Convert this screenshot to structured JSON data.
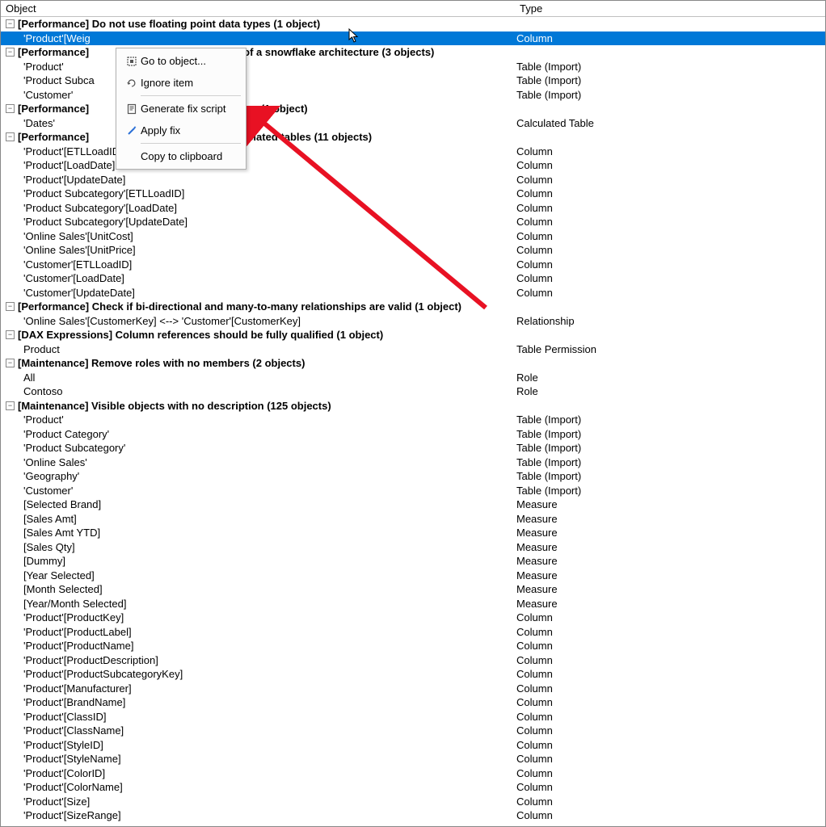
{
  "headers": {
    "object": "Object",
    "type": "Type"
  },
  "context_menu": {
    "go_to_object": "Go to object...",
    "ignore_item": "Ignore item",
    "generate_fix": "Generate fix script",
    "apply_fix": "Apply fix",
    "copy": "Copy to clipboard"
  },
  "groups": [
    {
      "label": "[Performance] Do not use floating point data types (1 object)",
      "items": [
        {
          "obj": "'Product'[Weig",
          "type": "Column",
          "selected": true
        }
      ]
    },
    {
      "label_prefix": "[Performance]",
      "label_suffix": "of a snowflake architecture (3 objects)",
      "items": [
        {
          "obj": "'Product'",
          "type": "Table (Import)"
        },
        {
          "obj": "'Product Subca",
          "type": "Table (Import)"
        },
        {
          "obj": "'Customer'",
          "type": "Table (Import)"
        }
      ]
    },
    {
      "label_prefix": "[Performance]",
      "label_suffix": "les (1 object)",
      "items": [
        {
          "obj": "'Dates'",
          "type": "Calculated Table"
        }
      ]
    },
    {
      "label_prefix": "[Performance]",
      "label_suffix": "related tables (11 objects)",
      "hide_suffix_under_menu": true,
      "items": [
        {
          "obj": "'Product'[ETLLoadID]",
          "type": "Column"
        },
        {
          "obj": "'Product'[LoadDate]",
          "type": "Column"
        },
        {
          "obj": "'Product'[UpdateDate]",
          "type": "Column"
        },
        {
          "obj": "'Product Subcategory'[ETLLoadID]",
          "type": "Column"
        },
        {
          "obj": "'Product Subcategory'[LoadDate]",
          "type": "Column"
        },
        {
          "obj": "'Product Subcategory'[UpdateDate]",
          "type": "Column"
        },
        {
          "obj": "'Online Sales'[UnitCost]",
          "type": "Column"
        },
        {
          "obj": "'Online Sales'[UnitPrice]",
          "type": "Column"
        },
        {
          "obj": "'Customer'[ETLLoadID]",
          "type": "Column"
        },
        {
          "obj": "'Customer'[LoadDate]",
          "type": "Column"
        },
        {
          "obj": "'Customer'[UpdateDate]",
          "type": "Column"
        }
      ]
    },
    {
      "label": "[Performance] Check if bi-directional and many-to-many relationships are valid (1 object)",
      "items": [
        {
          "obj": "'Online Sales'[CustomerKey] <--> 'Customer'[CustomerKey]",
          "type": "Relationship"
        }
      ]
    },
    {
      "label": "[DAX Expressions] Column references should be fully qualified (1 object)",
      "items": [
        {
          "obj": "Product",
          "type": "Table Permission"
        }
      ]
    },
    {
      "label": "[Maintenance] Remove roles with no members (2 objects)",
      "items": [
        {
          "obj": "All",
          "type": "Role"
        },
        {
          "obj": "Contoso",
          "type": "Role"
        }
      ]
    },
    {
      "label": "[Maintenance] Visible objects with no description (125 objects)",
      "items": [
        {
          "obj": "'Product'",
          "type": "Table (Import)"
        },
        {
          "obj": "'Product Category'",
          "type": "Table (Import)"
        },
        {
          "obj": "'Product Subcategory'",
          "type": "Table (Import)"
        },
        {
          "obj": "'Online Sales'",
          "type": "Table (Import)"
        },
        {
          "obj": "'Geography'",
          "type": "Table (Import)"
        },
        {
          "obj": "'Customer'",
          "type": "Table (Import)"
        },
        {
          "obj": "[Selected Brand]",
          "type": "Measure"
        },
        {
          "obj": "[Sales Amt]",
          "type": "Measure"
        },
        {
          "obj": "[Sales Amt YTD]",
          "type": "Measure"
        },
        {
          "obj": "[Sales Qty]",
          "type": "Measure"
        },
        {
          "obj": "[Dummy]",
          "type": "Measure"
        },
        {
          "obj": "[Year Selected]",
          "type": "Measure"
        },
        {
          "obj": "[Month Selected]",
          "type": "Measure"
        },
        {
          "obj": "[Year/Month Selected]",
          "type": "Measure"
        },
        {
          "obj": "'Product'[ProductKey]",
          "type": "Column"
        },
        {
          "obj": "'Product'[ProductLabel]",
          "type": "Column"
        },
        {
          "obj": "'Product'[ProductName]",
          "type": "Column"
        },
        {
          "obj": "'Product'[ProductDescription]",
          "type": "Column"
        },
        {
          "obj": "'Product'[ProductSubcategoryKey]",
          "type": "Column"
        },
        {
          "obj": "'Product'[Manufacturer]",
          "type": "Column"
        },
        {
          "obj": "'Product'[BrandName]",
          "type": "Column"
        },
        {
          "obj": "'Product'[ClassID]",
          "type": "Column"
        },
        {
          "obj": "'Product'[ClassName]",
          "type": "Column"
        },
        {
          "obj": "'Product'[StyleID]",
          "type": "Column"
        },
        {
          "obj": "'Product'[StyleName]",
          "type": "Column"
        },
        {
          "obj": "'Product'[ColorID]",
          "type": "Column"
        },
        {
          "obj": "'Product'[ColorName]",
          "type": "Column"
        },
        {
          "obj": "'Product'[Size]",
          "type": "Column"
        },
        {
          "obj": "'Product'[SizeRange]",
          "type": "Column"
        }
      ]
    }
  ]
}
